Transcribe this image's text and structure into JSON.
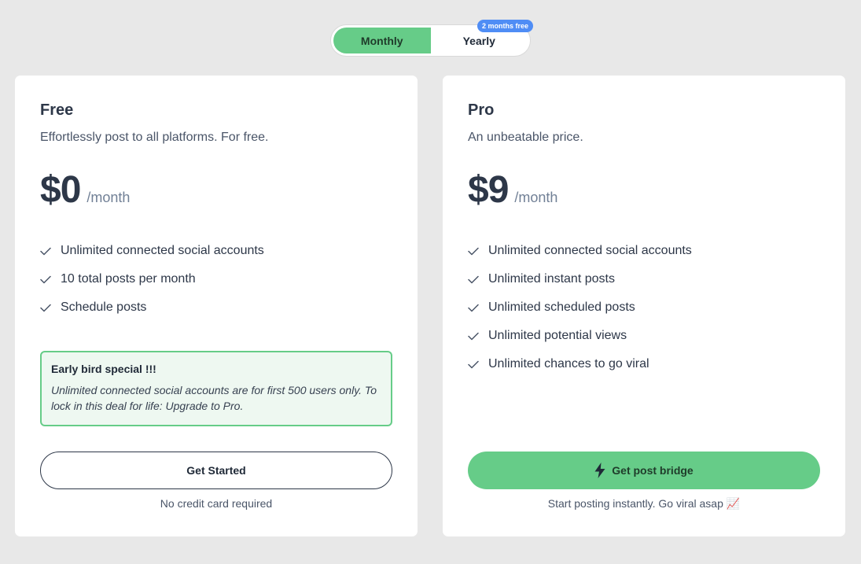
{
  "toggle": {
    "monthly_label": "Monthly",
    "yearly_label": "Yearly",
    "yearly_badge": "2 months free",
    "selected": "Monthly"
  },
  "plans": {
    "free": {
      "name": "Free",
      "description": "Effortlessly post to all platforms. For free.",
      "price": "$0",
      "period": "/month",
      "features": [
        "Unlimited connected social accounts",
        "10 total posts per month",
        "Schedule posts"
      ],
      "promo": {
        "title": "Early bird special !!!",
        "text": "Unlimited connected social accounts are for first 500 users only. To lock in this deal for life: Upgrade to Pro."
      },
      "cta": "Get Started",
      "footnote": "No credit card required"
    },
    "pro": {
      "name": "Pro",
      "description": "An unbeatable price.",
      "price": "$9",
      "period": "/month",
      "features": [
        "Unlimited connected social accounts",
        "Unlimited instant posts",
        "Unlimited scheduled posts",
        "Unlimited potential views",
        "Unlimited chances to go viral"
      ],
      "cta": "Get post bridge",
      "cta_icon": "lightning-bolt-icon",
      "footnote": "Start posting instantly. Go viral asap 📈"
    }
  },
  "colors": {
    "accent": "#66cc88",
    "badge": "#4f8df5",
    "background": "#e8e8e8",
    "card": "#ffffff"
  }
}
